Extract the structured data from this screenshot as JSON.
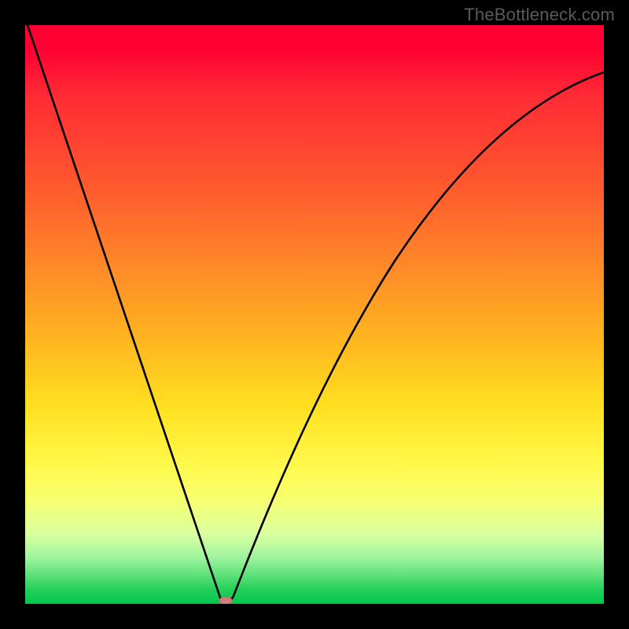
{
  "watermark": "TheBottleneck.com",
  "chart_data": {
    "type": "line",
    "title": "",
    "xlabel": "",
    "ylabel": "",
    "xlim": [
      0,
      100
    ],
    "ylim": [
      0,
      100
    ],
    "grid": false,
    "background_gradient": {
      "direction": "vertical",
      "stops": [
        {
          "pos": 0,
          "color": "#ff0033"
        },
        {
          "pos": 28,
          "color": "#ff5a2e"
        },
        {
          "pos": 54,
          "color": "#ffb41f"
        },
        {
          "pos": 76,
          "color": "#fff94b"
        },
        {
          "pos": 92,
          "color": "#9ef59e"
        },
        {
          "pos": 100,
          "color": "#00c84c"
        }
      ]
    },
    "series": [
      {
        "name": "bottleneck-curve",
        "color": "#000000",
        "x": [
          0,
          5,
          10,
          15,
          20,
          25,
          30,
          33,
          34,
          35,
          36,
          38,
          42,
          48,
          55,
          62,
          70,
          78,
          86,
          93,
          100
        ],
        "y": [
          100,
          85,
          70,
          55,
          40,
          25,
          10,
          2,
          0,
          1,
          4,
          10,
          22,
          38,
          52,
          62,
          70,
          76,
          80,
          83,
          85
        ]
      }
    ],
    "marker": {
      "name": "optimal-point",
      "x": 34,
      "y": 0,
      "color": "#d08080",
      "shape": "ellipse"
    }
  }
}
